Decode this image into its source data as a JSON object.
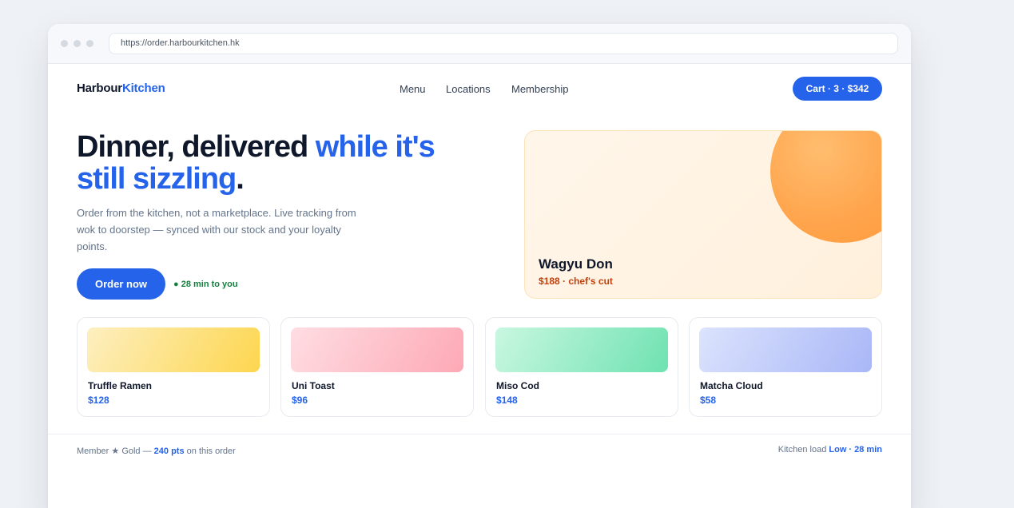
{
  "browser": {
    "url": "https://order.harbourkitchen.hk"
  },
  "brand": {
    "name_part1": "Harbour",
    "name_part2": "Kitchen",
    "accent_color": "#2563eb"
  },
  "nav": {
    "items": [
      {
        "label": "Menu"
      },
      {
        "label": "Locations"
      },
      {
        "label": "Membership"
      }
    ]
  },
  "cart": {
    "label": "Cart · 3 · $342"
  },
  "hero": {
    "headline_dark": "Dinner, delivered ",
    "headline_blue_1": "while it's",
    "headline_blue_2": "still sizzling",
    "headline_end": ".",
    "subcopy": "Order from the kitchen, not a marketplace. Live tracking from wok to doorstep — synced with our stock and your loyalty points.",
    "cta_label": "Order now",
    "eta": "● 28 min to you"
  },
  "featured": {
    "name": "Wagyu Don",
    "price_note": "$188 · chef's cut"
  },
  "menu_cards": [
    {
      "name": "Truffle Ramen",
      "price": "$128",
      "from": "#fdefc0",
      "to": "#fdd64f"
    },
    {
      "name": "Uni Toast",
      "price": "$96",
      "from": "#ffdde3",
      "to": "#fda9b5"
    },
    {
      "name": "Miso Cod",
      "price": "$148",
      "from": "#c9f7e1",
      "to": "#6fe2b1"
    },
    {
      "name": "Matcha Cloud",
      "price": "$58",
      "from": "#dbe3fd",
      "to": "#a9b7f7"
    }
  ],
  "footer": {
    "member_prefix": "Member ★ Gold — ",
    "points": "240 pts",
    "member_suffix": " on this order",
    "load_prefix": "Kitchen load ",
    "load_value": "Low · 28 min"
  }
}
